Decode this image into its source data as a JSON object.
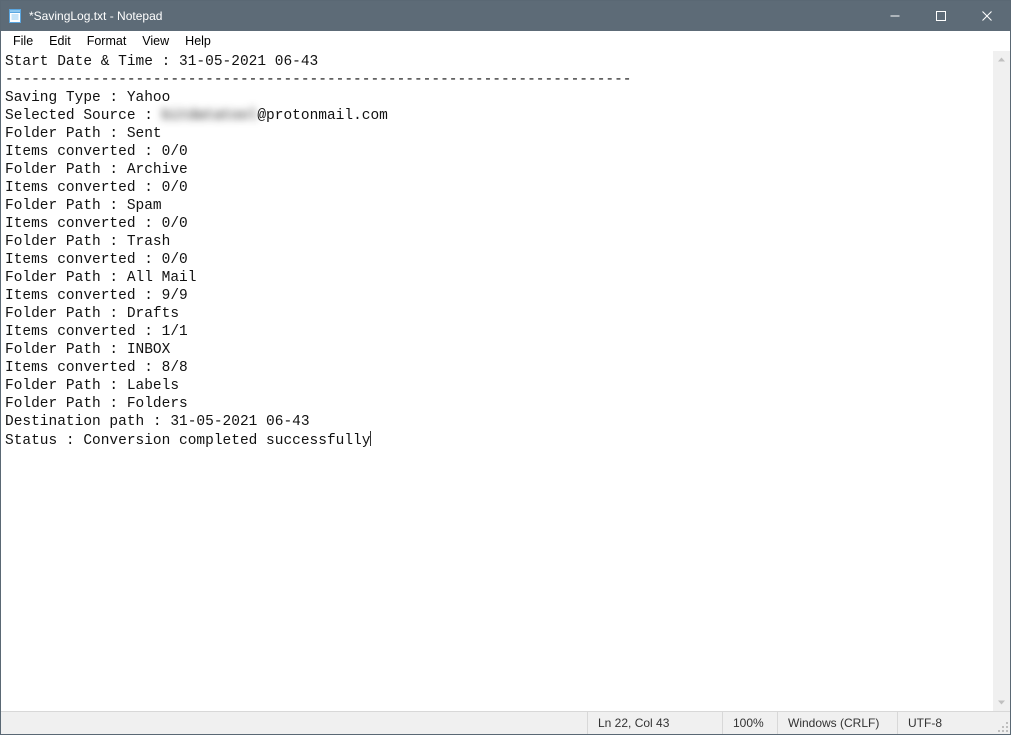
{
  "window": {
    "title": "*SavingLog.txt - Notepad"
  },
  "menu": {
    "file": "File",
    "edit": "Edit",
    "format": "Format",
    "view": "View",
    "help": "Help"
  },
  "content": {
    "lines": [
      "Start Date & Time : 31-05-2021 06-43",
      "------------------------------------------------------------------------",
      "Saving Type : Yahoo",
      "Folder Path : Sent",
      "Items converted : 0/0",
      "Folder Path : Archive",
      "Items converted : 0/0",
      "Folder Path : Spam",
      "Items converted : 0/0",
      "Folder Path : Trash",
      "Items converted : 0/0",
      "Folder Path : All Mail",
      "Items converted : 9/9",
      "Folder Path : Drafts",
      "Items converted : 1/1",
      "Folder Path : INBOX",
      "Items converted : 8/8",
      "Folder Path : Labels",
      "Folder Path : Folders",
      "Destination path : 31-05-2021 06-43",
      "Status : Conversion completed successfully"
    ],
    "source_line_prefix": "Selected Source : ",
    "source_redacted": "bitdatatool",
    "source_suffix": "@protonmail.com",
    "source_insert_after_index": 2
  },
  "status": {
    "position": "Ln 22, Col 43",
    "zoom": "100%",
    "eol": "Windows (CRLF)",
    "encoding": "UTF-8"
  }
}
